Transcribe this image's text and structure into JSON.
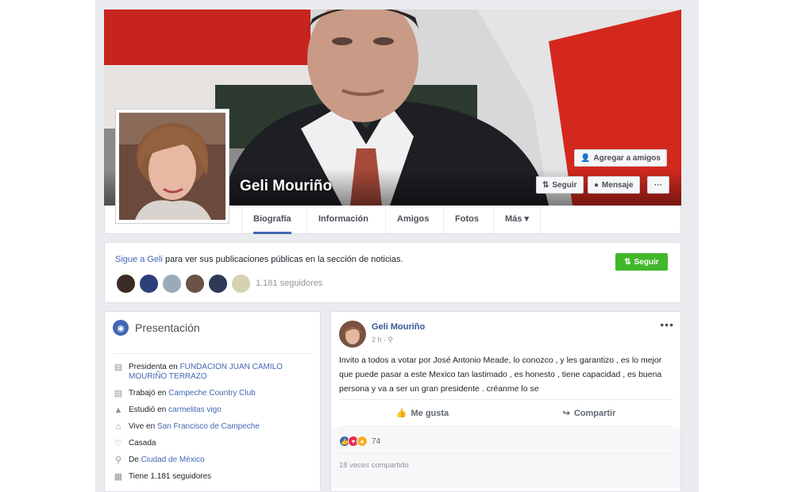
{
  "profile": {
    "name": "Geli Mouriño"
  },
  "cover_buttons": {
    "add_friend": "Agregar a amigos",
    "follow": "Seguir",
    "message": "Mensaje",
    "more": "···"
  },
  "nav": {
    "tabs": [
      "Biografía",
      "Información",
      "Amigos",
      "Fotos",
      "Más ▾"
    ]
  },
  "follow_box": {
    "prefix": "Sigue a Geli",
    "suffix": " para ver sus publicaciones públicas en la sección de noticias.",
    "button": "Seguir",
    "followers": "1.181 seguidores"
  },
  "intro": {
    "title": "Presentación",
    "rows": [
      {
        "icon": "briefcase-icon",
        "label": "Presidenta en ",
        "link": "FUNDACION JUAN CAMILO MOURIÑO TERRAZO"
      },
      {
        "icon": "briefcase-icon",
        "label": "Trabajó en ",
        "link": "Campeche Country Club"
      },
      {
        "icon": "graduation-icon",
        "label": "Estudió en ",
        "link": "carmelitas vigo"
      },
      {
        "icon": "home-icon",
        "label": "Vive en ",
        "link": "San Francisco de Campeche"
      },
      {
        "icon": "heart-icon",
        "label": "Casada",
        "link": ""
      },
      {
        "icon": "location-icon",
        "label": "De ",
        "link": "Ciudad de México"
      },
      {
        "icon": "followers-icon",
        "label": "Tiene 1.181 seguidores",
        "link": ""
      }
    ]
  },
  "post": {
    "author": "Geli Mouriño",
    "time": "2 h · ⚲",
    "menu": "•••",
    "text": "Invito a todos a votar por José Antonio Meade, lo conozco , y les garantizo , es lo mejor que puede pasar a este Mexico tan lastimado , es honesto , tiene capacidad , es buena persona y va a ser un gran presidente . créanme lo se",
    "like": "Me gusta",
    "share": "Compartir",
    "reactions_count": "74",
    "shares": "18 veces compartido"
  },
  "colors": {
    "fb_blue": "#4267b2",
    "follow_green": "#42b72a",
    "flag_red": "#ce1126"
  }
}
